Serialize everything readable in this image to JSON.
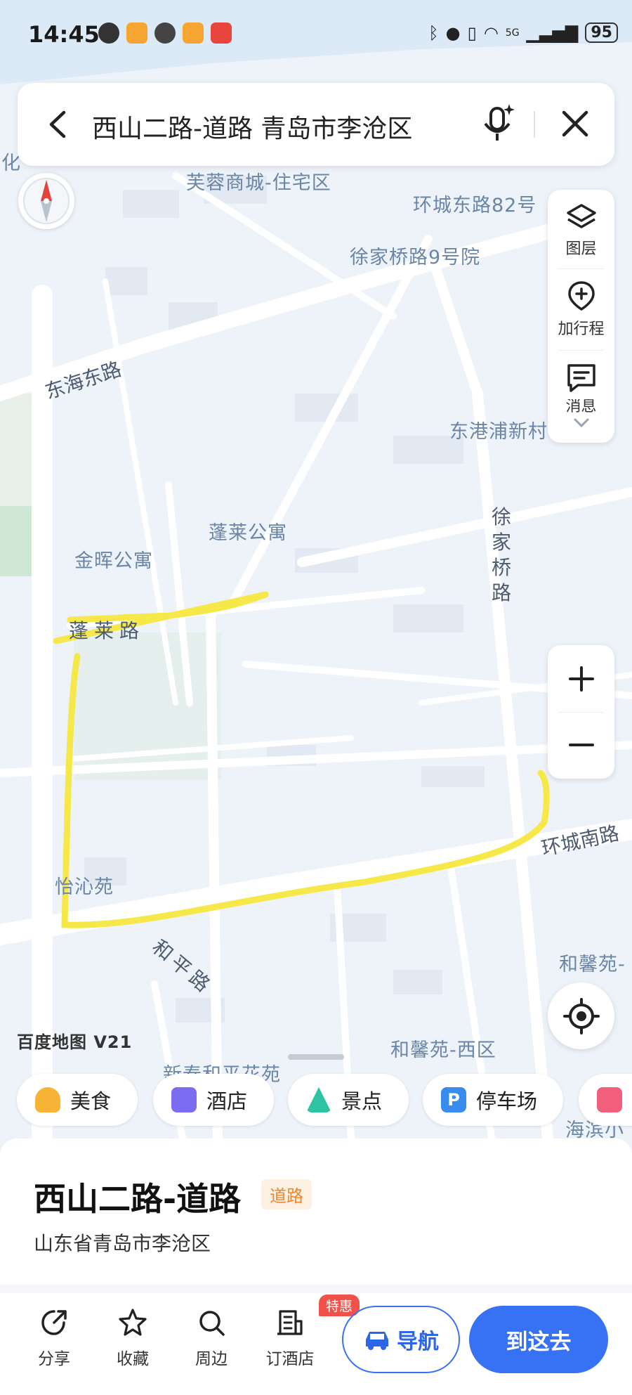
{
  "status_bar": {
    "time": "14:45",
    "battery": "95",
    "network": "5G"
  },
  "search": {
    "query": "西山二路-道路 青岛市李沧区"
  },
  "map": {
    "labels": [
      "芙蓉商城-住宅区",
      "环城东路82号",
      "徐家桥路9号院",
      "东港浦新村",
      "蓬莱公寓",
      "金晖公寓",
      "怡沁苑",
      "和馨苑-",
      "和馨苑-西区",
      "新泰和平花苑",
      "海滨小",
      "化"
    ],
    "roads": [
      "东海东路",
      "徐家桥路",
      "蓬莱路",
      "环城南路",
      "和平路"
    ],
    "brand": "百度地图 V21",
    "route_color": "#f7e84a"
  },
  "tools": {
    "layers": "图层",
    "add_trip": "加行程",
    "message": "消息"
  },
  "categories": [
    {
      "label": "美食",
      "color": "#f7b335",
      "icon": "food-icon"
    },
    {
      "label": "酒店",
      "color": "#7b6cf2",
      "icon": "hotel-icon"
    },
    {
      "label": "景点",
      "color": "#2ec3a3",
      "icon": "scenic-icon"
    },
    {
      "label": "停车场",
      "color": "#3a8bf0",
      "icon": "parking-icon"
    }
  ],
  "place": {
    "name": "西山二路-道路",
    "tag": "道路",
    "address": "山东省青岛市李沧区"
  },
  "actions": {
    "share": "分享",
    "favorite": "收藏",
    "nearby": "周边",
    "book_hotel": "订酒店",
    "hotel_badge": "特惠",
    "navigate": "导航",
    "go_here": "到这去"
  }
}
